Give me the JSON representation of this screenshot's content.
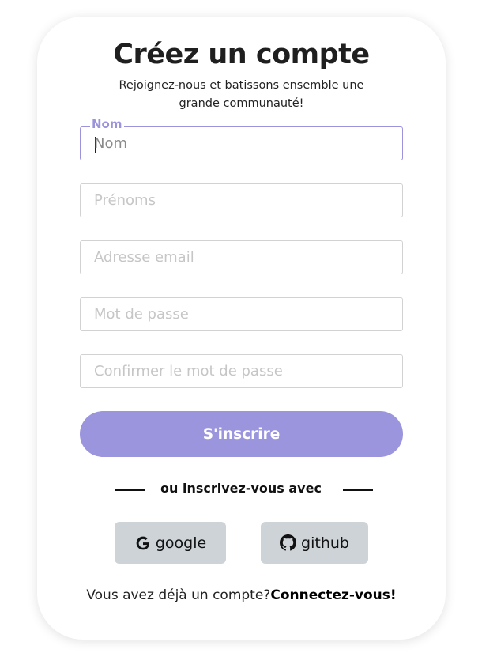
{
  "form": {
    "title": "Créez un compte",
    "subtitle": "Rejoignez-nous et batissons ensemble une grande communauté!",
    "fields": [
      {
        "label": "Nom",
        "placeholder": "Nom",
        "value": ""
      },
      {
        "placeholder": "Prénoms",
        "value": ""
      },
      {
        "placeholder": "Adresse email",
        "value": ""
      },
      {
        "placeholder": "Mot de passe",
        "value": ""
      },
      {
        "placeholder": "Confirmer le mot de passe",
        "value": ""
      }
    ],
    "submit_label": "S'inscrire",
    "divider_text": "ou inscrivez-vous avec",
    "social": {
      "google_label": "google",
      "github_label": "github",
      "google_icon": "google-icon",
      "github_icon": "github-icon"
    },
    "signin_prompt": "Vous avez déjà un compte?",
    "signin_link": "Connectez-vous!"
  },
  "colors": {
    "accent": "#9b95de",
    "social_bg": "#ced3d8",
    "text": "#1f1f1f"
  }
}
